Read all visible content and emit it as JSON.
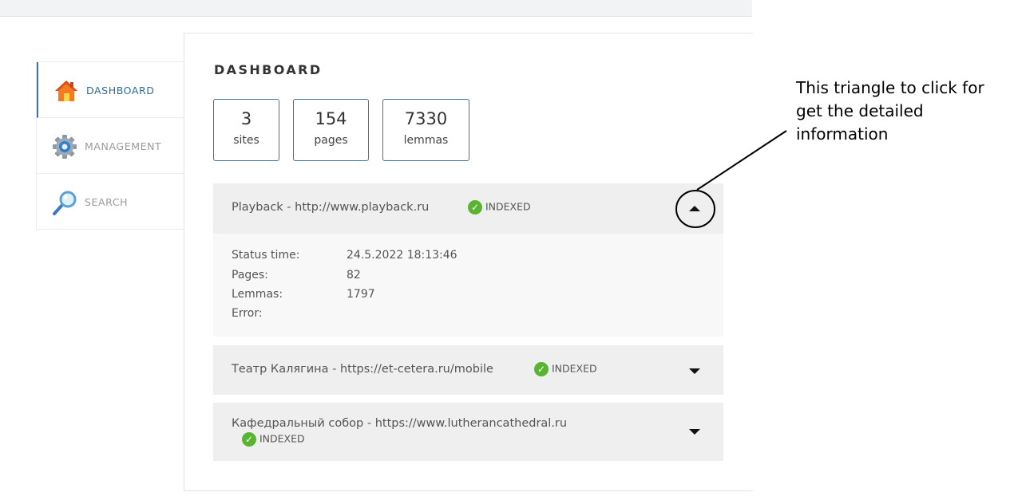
{
  "sidebar": {
    "items": [
      {
        "label": "DASHBOARD",
        "icon": "house-icon"
      },
      {
        "label": "MANAGEMENT",
        "icon": "gear-icon"
      },
      {
        "label": "SEARCH",
        "icon": "magnifier-icon"
      }
    ]
  },
  "main": {
    "title": "DASHBOARD",
    "stats": [
      {
        "value": "3",
        "label": "sites"
      },
      {
        "value": "154",
        "label": "pages"
      },
      {
        "value": "7330",
        "label": "lemmas"
      }
    ],
    "sites": [
      {
        "title": "Playback - http://www.playback.ru",
        "status": "INDEXED",
        "expanded": true,
        "details": {
          "status_time_label": "Status time:",
          "status_time": "24.5.2022 18:13:46",
          "pages_label": "Pages:",
          "pages": "82",
          "lemmas_label": "Lemmas:",
          "lemmas": "1797",
          "error_label": "Error:",
          "error": ""
        }
      },
      {
        "title": "Театр Калягина - https://et-cetera.ru/mobile",
        "status": "INDEXED",
        "expanded": false
      },
      {
        "title": "Кафедральный собор - https://www.lutherancathedral.ru",
        "status": "INDEXED",
        "expanded": false
      }
    ]
  },
  "annotation": {
    "text": "This triangle to click for get the detailed information"
  },
  "colors": {
    "accent": "#3b74a3",
    "status_green": "#5ab432",
    "row_bg": "#efefef"
  }
}
